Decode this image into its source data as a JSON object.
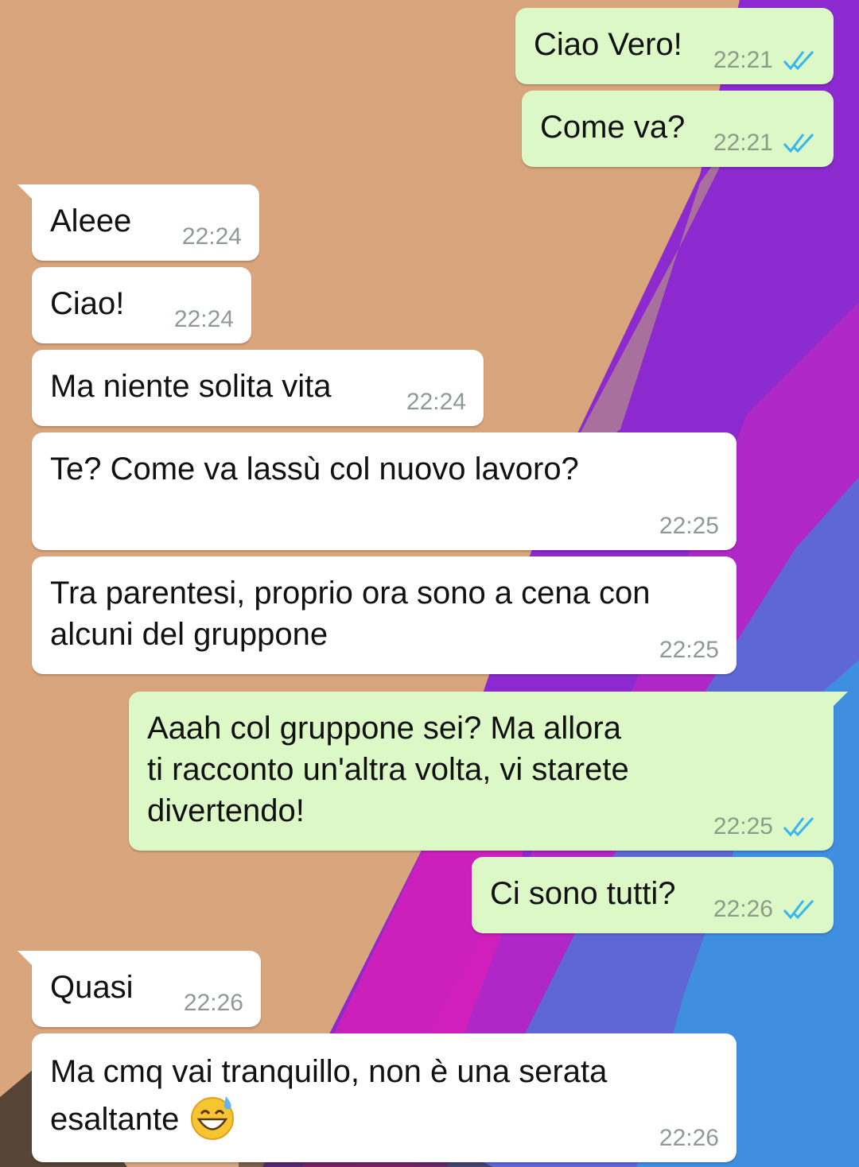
{
  "colors": {
    "outgoing_bubble": "#dcf8c6",
    "incoming_bubble": "#ffffff",
    "read_ticks": "#34b7f1",
    "timestamp": "#8f9a94"
  },
  "messages": [
    {
      "direction": "out",
      "text": "Ciao Vero!",
      "time": "22:21",
      "status": "read"
    },
    {
      "direction": "out",
      "text": "Come va?",
      "time": "22:21",
      "status": "read"
    },
    {
      "direction": "in",
      "text": "Aleee",
      "time": "22:24"
    },
    {
      "direction": "in",
      "text": "Ciao!",
      "time": "22:24"
    },
    {
      "direction": "in",
      "text": "Ma niente solita vita",
      "time": "22:24"
    },
    {
      "direction": "in",
      "text": "Te? Come va lassù col nuovo lavoro?",
      "time": "22:25"
    },
    {
      "direction": "in",
      "text_lines": [
        "Tra parentesi, proprio ora sono a cena con",
        "alcuni del gruppone"
      ],
      "time": "22:25"
    },
    {
      "direction": "out",
      "text_lines": [
        "Aaah col gruppone sei? Ma allora",
        "ti racconto un'altra volta, vi starete",
        "divertendo!"
      ],
      "time": "22:25",
      "status": "read"
    },
    {
      "direction": "out",
      "text": "Ci sono tutti?",
      "time": "22:26",
      "status": "read"
    },
    {
      "direction": "in",
      "text": "Quasi",
      "time": "22:26"
    },
    {
      "direction": "in",
      "text_lines": [
        "Ma cmq vai tranquillo, non è una serata",
        "esaltante"
      ],
      "time": "22:26",
      "emoji": "grinning-face-with-sweat-icon"
    }
  ]
}
